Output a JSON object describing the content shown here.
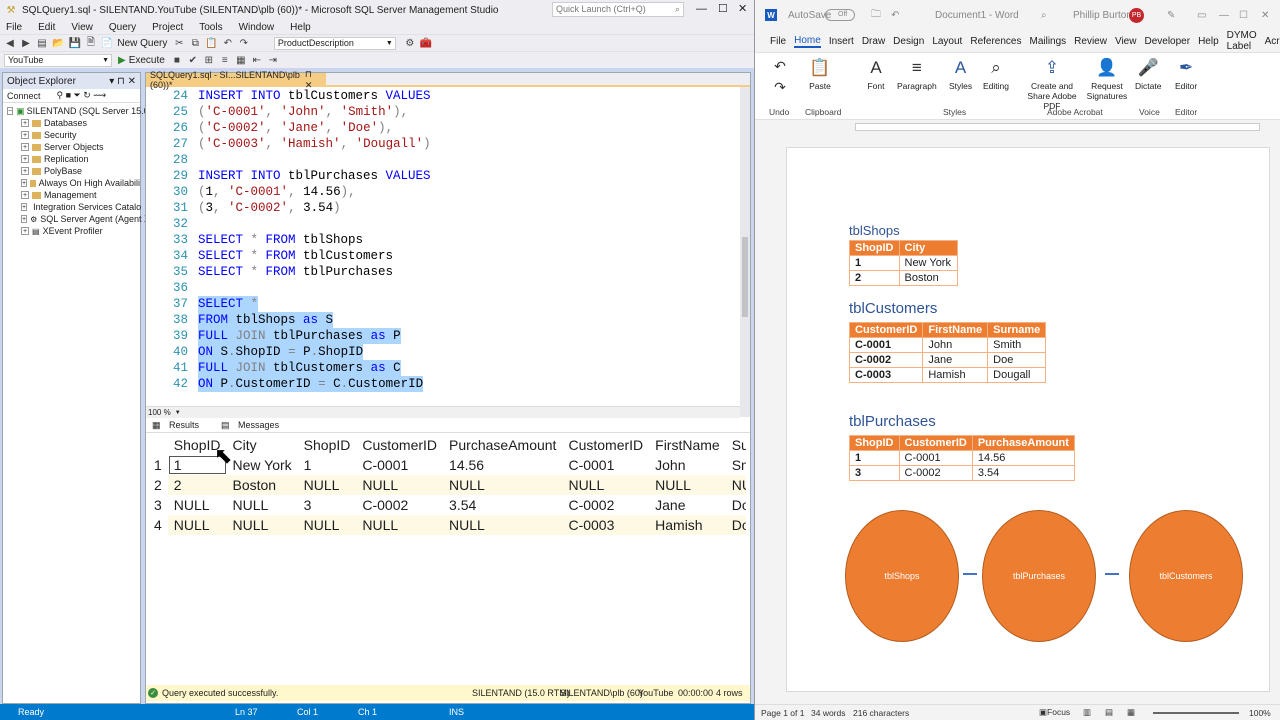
{
  "ssms": {
    "title": "SQLQuery1.sql - SILENTAND.YouTube (SILENTAND\\plb (60))* - Microsoft SQL Server Management Studio",
    "quick_launch": "Quick Launch (Ctrl+Q)",
    "menu": [
      "File",
      "Edit",
      "View",
      "Query",
      "Project",
      "Tools",
      "Window",
      "Help"
    ],
    "toolbar": {
      "new_query": "New Query",
      "combo_value": "ProductDescription",
      "database": "YouTube",
      "execute": "Execute"
    },
    "object_explorer": {
      "title": "Object Explorer",
      "connect": "Connect",
      "server": "SILENTAND (SQL Server 15.0.2",
      "nodes": [
        "Databases",
        "Security",
        "Server Objects",
        "Replication",
        "PolyBase",
        "Always On High Availabili",
        "Management",
        "Integration Services Catalo",
        "SQL Server Agent (Agent X",
        "XEvent Profiler"
      ]
    },
    "doc_tab": "SQLQuery1.sql - SI...SILENTAND\\plb (60))*",
    "zoom": "100 %",
    "result_tabs": [
      "Results",
      "Messages"
    ],
    "results": {
      "columns": [
        "",
        "ShopID",
        "City",
        "ShopID",
        "CustomerID",
        "PurchaseAmount",
        "CustomerID",
        "FirstName",
        "Su"
      ],
      "rows": [
        [
          "1",
          "1",
          "New York",
          "1",
          "C-0001",
          "14.56",
          "C-0001",
          "John",
          "Sn"
        ],
        [
          "2",
          "2",
          "Boston",
          "NULL",
          "NULL",
          "NULL",
          "NULL",
          "NULL",
          "NU"
        ],
        [
          "3",
          "NULL",
          "NULL",
          "3",
          "C-0002",
          "3.54",
          "C-0002",
          "Jane",
          "Do"
        ],
        [
          "4",
          "NULL",
          "NULL",
          "NULL",
          "NULL",
          "NULL",
          "C-0003",
          "Hamish",
          "Do"
        ]
      ]
    },
    "status": {
      "message": "Query executed successfully.",
      "server": "SILENTAND (15.0 RTM)",
      "user": "SILENTAND\\plb (60)",
      "db": "YouTube",
      "time": "00:00:00",
      "rows": "4 rows"
    },
    "bottom": {
      "ready": "Ready",
      "ln": "Ln 37",
      "col": "Col 1",
      "ch": "Ch 1",
      "ins": "INS"
    }
  },
  "word": {
    "autosave": "AutoSave",
    "autosave_state": "Off",
    "doc_title": "Document1 - Word",
    "user": "Phillip Burton",
    "initials": "PB",
    "tabs": [
      "File",
      "Home",
      "Insert",
      "Draw",
      "Design",
      "Layout",
      "References",
      "Mailings",
      "Review",
      "View",
      "Developer",
      "Help",
      "DYMO Label",
      "Acrob"
    ],
    "ribbon": {
      "paste": "Paste",
      "font": "Font",
      "paragraph": "Paragraph",
      "styles": "Styles",
      "editing": "Editing",
      "create_share": "Create and Share Adobe PDF",
      "request_sig": "Request Signatures",
      "dictate": "Dictate",
      "editor": "Editor",
      "groups": [
        "Undo",
        "Clipboard",
        "Styles",
        "Adobe Acrobat",
        "Voice",
        "Editor"
      ]
    },
    "shops": {
      "heading": "tblShops",
      "cols": [
        "ShopID",
        "City"
      ],
      "rows": [
        [
          "1",
          "New York"
        ],
        [
          "2",
          "Boston"
        ]
      ]
    },
    "customers": {
      "heading": "tblCustomers",
      "cols": [
        "CustomerID",
        "FirstName",
        "Surname"
      ],
      "rows": [
        [
          "C-0001",
          "John",
          "Smith"
        ],
        [
          "C-0002",
          "Jane",
          "Doe"
        ],
        [
          "C-0003",
          "Hamish",
          "Dougall"
        ]
      ]
    },
    "purchases": {
      "heading": "tblPurchases",
      "cols": [
        "ShopID",
        "CustomerID",
        "PurchaseAmount"
      ],
      "rows": [
        [
          "1",
          "C-0001",
          "14.56"
        ],
        [
          "3",
          "C-0002",
          "3.54"
        ]
      ]
    },
    "circles": [
      "tblShops",
      "tblPurchases",
      "tblCustomers"
    ],
    "status": {
      "page": "Page 1 of 1",
      "words": "34 words",
      "chars": "216 characters",
      "focus": "Focus",
      "zoom": "100%"
    }
  }
}
